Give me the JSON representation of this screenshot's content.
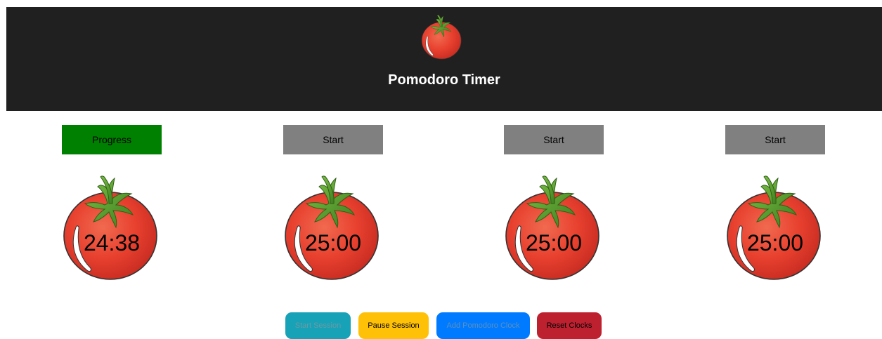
{
  "header": {
    "title": "Pomodoro Timer",
    "logo_icon": "tomato-icon"
  },
  "clocks": [
    {
      "button_label": "Progress",
      "button_color": "#008000",
      "time": "24:38"
    },
    {
      "button_label": "Start",
      "button_color": "#808080",
      "time": "25:00"
    },
    {
      "button_label": "Start",
      "button_color": "#808080",
      "time": "25:00"
    },
    {
      "button_label": "Start",
      "button_color": "#808080",
      "time": "25:00"
    }
  ],
  "controls": {
    "start_label": "Start Session",
    "pause_label": "Pause Session",
    "add_label": "Add Pomodoro Clock",
    "reset_label": "Reset Clocks"
  },
  "colors": {
    "header_bg": "#202020",
    "start_session": "#17a2b8",
    "pause_session": "#ffc107",
    "add_clock": "#007bff",
    "reset_clocks": "#bd2130",
    "tomato_red": "#e8402f",
    "leaf_green": "#4f9a2a"
  }
}
